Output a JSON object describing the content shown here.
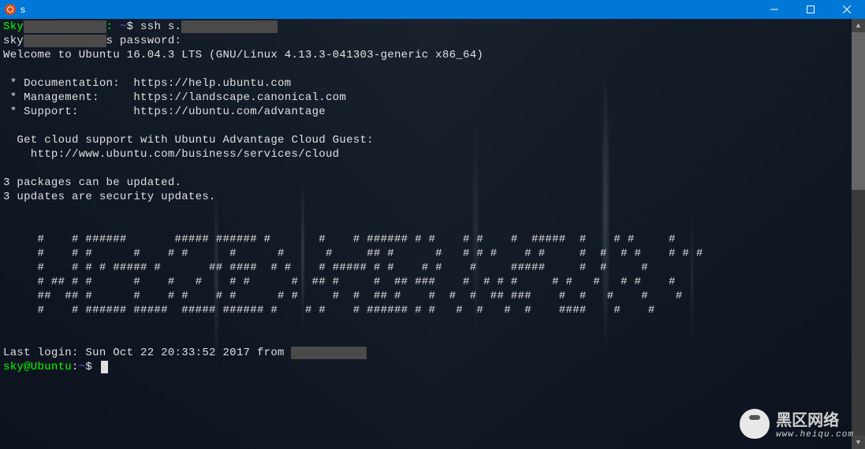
{
  "titlebar": {
    "title": "s"
  },
  "prompt1": {
    "user_host": "Sky",
    "redacted": "            ",
    "sep": ": ",
    "path": "~",
    "dollar": "$ ",
    "command": "ssh s.",
    "redacted2": "              "
  },
  "password_line": {
    "prefix": "sky",
    "redacted": "            ",
    "suffix": "s password:"
  },
  "welcome": "Welcome to Ubuntu 16.04.3 LTS (GNU/Linux 4.13.3-041303-generic x86_64)",
  "links": {
    "doc_label": " * Documentation:  ",
    "doc_url": "https://help.ubuntu.com",
    "mgmt_label": " * Management:     ",
    "mgmt_url": "https://landscape.canonical.com",
    "sup_label": " * Support:        ",
    "sup_url": "https://ubuntu.com/advantage"
  },
  "cloud": {
    "line1": "  Get cloud support with Ubuntu Advantage Cloud Guest:",
    "line2": "    http://www.ubuntu.com/business/services/cloud"
  },
  "updates": {
    "line1": "3 packages can be updated.",
    "line2": "3 updates are security updates."
  },
  "ascii": [
    "     #    # ######       ##### ###### #       #    # ###### # #    # #    #  #####  #    # #     #",
    "     #    # #      #    # #      #      #      #     ## #      #   # # #    # #     #  #  # #    # # #",
    "     #    # # # ##### #       ## ####  # #    # ##### # #    # #    #     #####     #  #     #",
    "     # ## # #      #    #   #    # #      #  ## #     #  ## ###    #  # # #     # #   #   # #    #",
    "     ##  ## #      #    # #    # #      # #     #  #  ## #    #  #  #  ## ###    #  #   #    #    #",
    "     #    # ###### #####  ##### ###### #    # #    # ###### # #   #  #   #  #    ####    #    #"
  ],
  "last_login": {
    "prefix": "Last login: Sun Oct 22 20:33:52 2017 from ",
    "redacted": "           "
  },
  "prompt2": {
    "user_host": "sky@Ubuntu",
    "sep": ":",
    "path": "~",
    "dollar": "$ "
  },
  "watermark": {
    "title": "黑区网络",
    "url": "www.heiqu.com"
  }
}
